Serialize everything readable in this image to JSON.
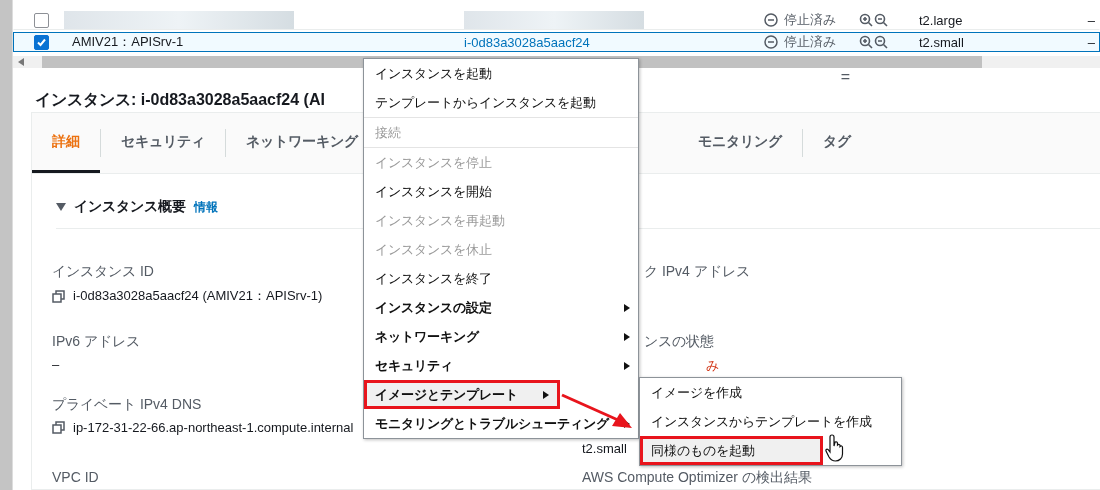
{
  "table": {
    "rows": [
      {
        "selected": false,
        "redacted": true,
        "status": "停止済み",
        "type": "t2.large",
        "extra": "–"
      },
      {
        "selected": true,
        "redacted": false,
        "name": "AMIV21：APISrv-1",
        "instance_id": "i-0d83a3028a5aacf24",
        "status": "停止済み",
        "type": "t2.small",
        "extra": "–"
      }
    ]
  },
  "resize_handle": "=",
  "detail": {
    "title": "インスタンス: i-0d83a3028a5aacf24 (AI",
    "tabs": [
      {
        "label": "詳細",
        "selected": true
      },
      {
        "label": "セキュリティ",
        "selected": false
      },
      {
        "label": "ネットワーキング",
        "selected": false
      },
      {
        "label": "モニタリング",
        "selected": false
      },
      {
        "label": "タグ",
        "selected": false
      }
    ],
    "section": {
      "title": "インスタンス概要",
      "expanded": true,
      "info_link": "情報"
    },
    "rows": [
      {
        "left": {
          "label": "インスタンス ID",
          "value": "i-0d83a3028a5aacf24 (AMIV21：APISrv-1)",
          "copyable": true
        },
        "right": {
          "label": "ク IPv4 アドレス"
        }
      },
      {
        "left": {
          "label": "IPv6 アドレス",
          "value": "–",
          "copyable": false
        },
        "right": {
          "label": "ンスの状態",
          "value": "み",
          "kind": "status"
        }
      },
      {
        "left": {
          "label": "プライベート IPv4 DNS",
          "value": "ip-172-31-22-66.ap-northeast-1.compute.internal",
          "copyable": true
        },
        "right": {
          "value": "t2.small",
          "kind": "text"
        }
      },
      {
        "left": {
          "label": "VPC ID"
        },
        "right": {
          "label": "AWS Compute Optimizer の検出結果"
        }
      }
    ]
  },
  "context_menu": {
    "groups": [
      [
        {
          "label": "インスタンスを起動",
          "kind": "action",
          "disabled": false,
          "highlighted": false,
          "annotated": false
        },
        {
          "label": "テンプレートからインスタンスを起動",
          "kind": "action",
          "disabled": false,
          "highlighted": false,
          "annotated": false
        }
      ],
      [
        {
          "label": "接続",
          "kind": "action",
          "disabled": true,
          "highlighted": false,
          "annotated": false
        }
      ],
      [
        {
          "label": "インスタンスを停止",
          "kind": "action",
          "disabled": true,
          "highlighted": false,
          "annotated": false
        },
        {
          "label": "インスタンスを開始",
          "kind": "action",
          "disabled": false,
          "highlighted": false,
          "annotated": false
        },
        {
          "label": "インスタンスを再起動",
          "kind": "action",
          "disabled": true,
          "highlighted": false,
          "annotated": false
        },
        {
          "label": "インスタンスを休止",
          "kind": "action",
          "disabled": true,
          "highlighted": false,
          "annotated": false
        },
        {
          "label": "インスタンスを終了",
          "kind": "action",
          "disabled": false,
          "highlighted": false,
          "annotated": false
        },
        {
          "label": "インスタンスの設定",
          "kind": "submenu",
          "disabled": false,
          "highlighted": false,
          "annotated": false
        },
        {
          "label": "ネットワーキング",
          "kind": "submenu",
          "disabled": false,
          "highlighted": false,
          "annotated": false
        },
        {
          "label": "セキュリティ",
          "kind": "submenu",
          "disabled": false,
          "highlighted": false,
          "annotated": false
        },
        {
          "label": "イメージとテンプレート",
          "kind": "submenu",
          "disabled": false,
          "highlighted": true,
          "annotated": true
        },
        {
          "label": "モニタリングとトラブルシューティング",
          "kind": "submenu",
          "disabled": false,
          "highlighted": false,
          "annotated": false
        }
      ]
    ]
  },
  "submenu": {
    "items": [
      {
        "label": "イメージを作成",
        "highlighted": false,
        "annotated": false
      },
      {
        "label": "インスタンスからテンプレートを作成",
        "highlighted": false,
        "annotated": false
      },
      {
        "label": "同様のものを起動",
        "highlighted": true,
        "annotated": true
      }
    ]
  }
}
